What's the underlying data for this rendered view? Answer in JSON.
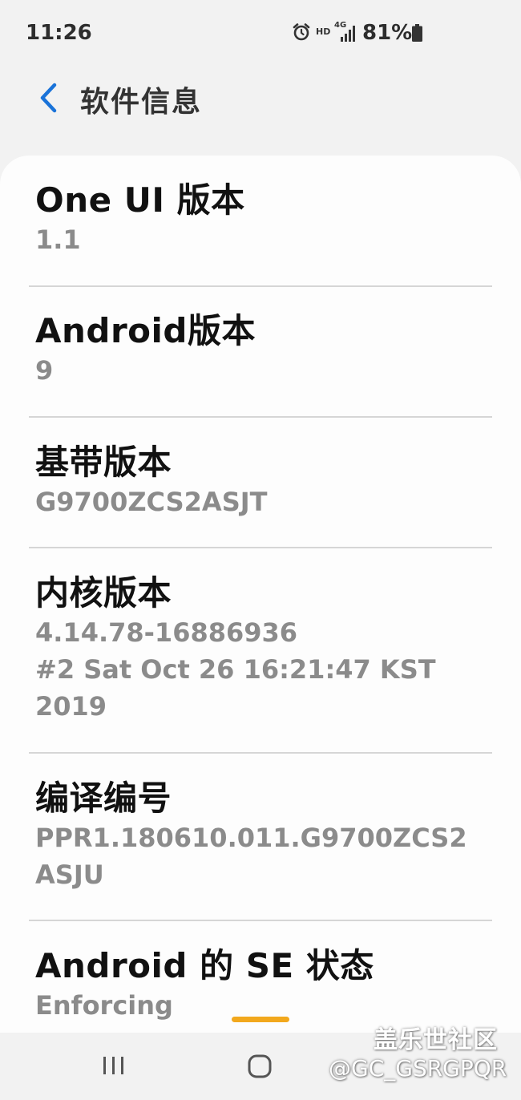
{
  "status_bar": {
    "time": "11:26",
    "hd_label": "HD",
    "network_label": "4G",
    "battery_percent": "81%",
    "icons": [
      "alarm-icon",
      "signal-icon",
      "battery-icon"
    ]
  },
  "header": {
    "back_icon": "chevron-left-icon",
    "title": "软件信息"
  },
  "items": [
    {
      "title": "One UI 版本",
      "value": "1.1"
    },
    {
      "title": "Android版本",
      "value": "9"
    },
    {
      "title": "基带版本",
      "value": "G9700ZCS2ASJT"
    },
    {
      "title": "内核版本",
      "value_lines": [
        "4.14.78-16886936",
        "#2 Sat Oct 26 16:21:47 KST",
        "2019"
      ]
    },
    {
      "title": "编译编号",
      "value_lines": [
        "PPR1.180610.011.G9700ZCS2",
        "ASJU"
      ]
    },
    {
      "title": "Android 的 SE 状态",
      "value": "Enforcing"
    }
  ],
  "nav_bar": {
    "icons": [
      "recent-apps-icon",
      "home-icon"
    ]
  },
  "watermark": {
    "line1": "盖乐世社区",
    "line2": "@GC_GSRGPQR"
  },
  "colors": {
    "background": "#f2f2f2",
    "card": "#fdfdfd",
    "accent": "#1a73d9",
    "scroll_indicator": "#f2a81d",
    "value_text": "#8b8b8b"
  }
}
